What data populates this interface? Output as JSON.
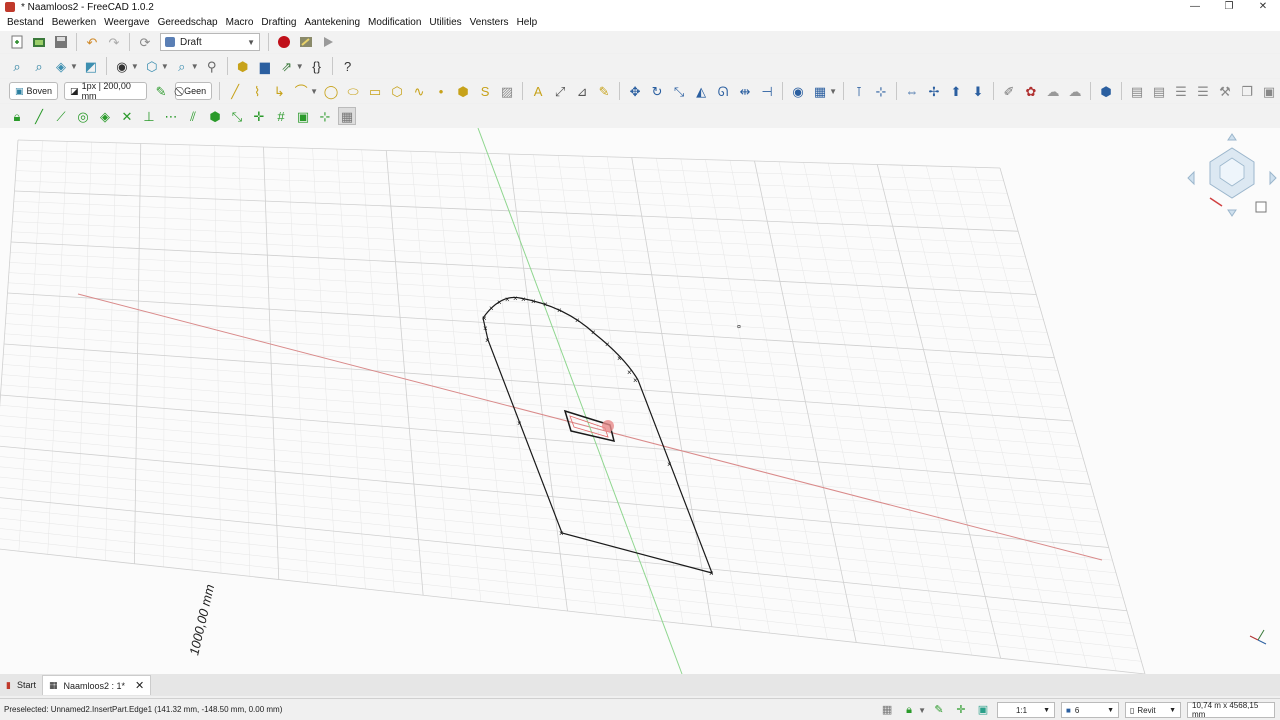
{
  "window": {
    "title": "* Naamloos2 - FreeCAD 1.0.2",
    "controls": [
      "—",
      "❐",
      "✕"
    ]
  },
  "menu": [
    "Bestand",
    "Bewerken",
    "Weergave",
    "Gereedschap",
    "Macro",
    "Drafting",
    "Aantekening",
    "Modification",
    "Utilities",
    "Vensters",
    "Help"
  ],
  "workbench": {
    "selected": "Draft"
  },
  "draft_tray": {
    "plane_label": "Boven",
    "style_label": "1px | 200,00 mm",
    "group_label": "Geen"
  },
  "viewport": {
    "scale_label": "1000,00 mm",
    "colors": {
      "background": "#fbfbfb",
      "grid": "#d7d7d7",
      "axis_x": "#d98a8a",
      "axis_y": "#8fd68f",
      "wire": "#1a1a1a",
      "preselect": "#e26a6a"
    }
  },
  "tabs": [
    {
      "label": "Start",
      "active": false
    },
    {
      "label": "Naamloos2 : 1*",
      "active": true,
      "close": "✕"
    }
  ],
  "status": {
    "preselected": "Preselected: Unnamed2.InsertPart.Edge1 (141.32 mm, -148.50 mm, 0.00 mm)",
    "scale": "1:1",
    "snap_count": "6",
    "nav_style": "Revit",
    "dimensions": "10,74 m x 4568,15 mm"
  }
}
